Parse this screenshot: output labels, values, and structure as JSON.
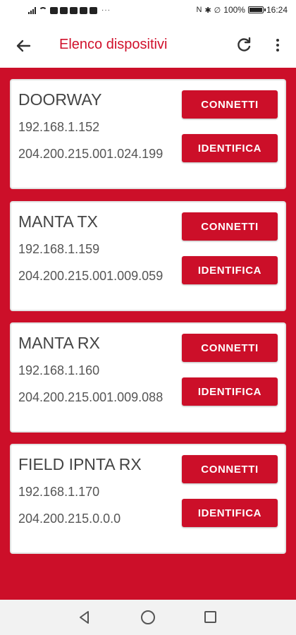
{
  "status_bar": {
    "icons_left": [
      "signal-icon",
      "wifi-icon",
      "app-notification-icons",
      "more-notifications-icon"
    ],
    "more_glyph": "···",
    "nfc_glyph": "N",
    "bluetooth_glyph": "✱",
    "mute_glyph": "∅",
    "battery_text": "100%",
    "battery_level": 1.0,
    "time": "16:24"
  },
  "app_bar": {
    "title": "Elenco dispositivi",
    "back_icon": "arrow-left-icon",
    "refresh_icon": "refresh-icon",
    "menu_icon": "more-vert-icon"
  },
  "colors": {
    "accent": "#cc0f29",
    "title": "#d0102b"
  },
  "devices": [
    {
      "name": "DOORWAY",
      "ip": "192.168.1.152",
      "mac": "204.200.215.001.024.199",
      "connect_label": "CONNETTI",
      "identify_label": "IDENTIFICA"
    },
    {
      "name": "MANTA TX",
      "ip": "192.168.1.159",
      "mac": "204.200.215.001.009.059",
      "connect_label": "CONNETTI",
      "identify_label": "IDENTIFICA"
    },
    {
      "name": "MANTA RX",
      "ip": "192.168.1.160",
      "mac": "204.200.215.001.009.088",
      "connect_label": "CONNETTI",
      "identify_label": "IDENTIFICA"
    },
    {
      "name": "FIELD IPNTA RX",
      "ip": "192.168.1.170",
      "mac": "204.200.215.0.0.0",
      "connect_label": "CONNETTI",
      "identify_label": "IDENTIFICA"
    }
  ],
  "nav_bar": {
    "icons": [
      "nav-back-icon",
      "nav-home-icon",
      "nav-recents-icon"
    ]
  }
}
